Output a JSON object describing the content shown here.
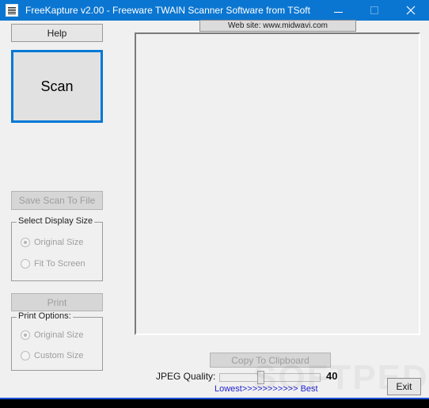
{
  "window": {
    "title": "FreeKapture v2.00 - Freeware TWAIN Scanner Software from TSoft",
    "icon": "document-lines-icon",
    "accent_color": "#0b76d1",
    "face_color": "#f0f0f0",
    "caption_buttons": {
      "minimize": "minimize-icon",
      "maximize": "maximize-icon",
      "close": "close-icon"
    }
  },
  "left_panel": {
    "help_label": "Help",
    "scan_label": "Scan",
    "save_scan_label": "Save Scan To File",
    "print_label": "Print",
    "display_size_group": {
      "title": "Select Display Size",
      "options": [
        {
          "label": "Original Size",
          "checked": true
        },
        {
          "label": "Fit To Screen",
          "checked": false
        }
      ]
    },
    "print_options_group": {
      "title": "Print Options:",
      "options": [
        {
          "label": "Original Size",
          "checked": true
        },
        {
          "label": "Custom Size",
          "checked": false
        }
      ]
    }
  },
  "preview": {
    "website_label": "Web site: www.midwavi.com",
    "image_content": ""
  },
  "bottom": {
    "copy_clipboard_label": "Copy To Clipboard",
    "jpeg_quality_label": "JPEG Quality:",
    "jpeg_quality_value": "40",
    "quality_scale_label": "Lowest>>>>>>>>>>> Best",
    "exit_label": "Exit"
  },
  "watermark": {
    "text": "SOFTPEDIA"
  }
}
